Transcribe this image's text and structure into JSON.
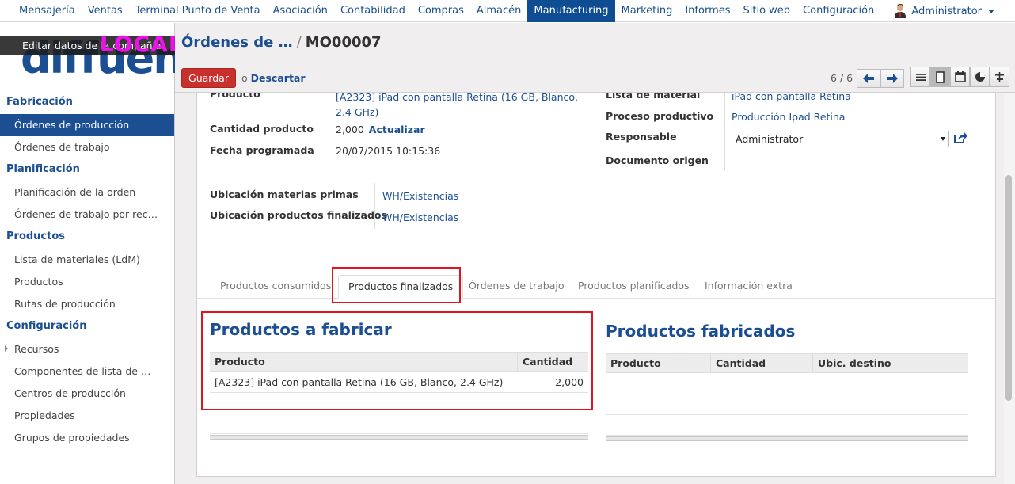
{
  "topbar": {
    "menu": [
      "Mensajería",
      "Ventas",
      "Terminal Punto de Venta",
      "Asociación",
      "Contabilidad",
      "Compras",
      "Almacén",
      "Manufacturing",
      "Marketing",
      "Informes",
      "Sitio web",
      "Configuración"
    ],
    "active": "Manufacturing",
    "user": "Administrator"
  },
  "sidebar": {
    "logo_text": "diffuen",
    "edit_company": "Editar datos de la compañía",
    "badge": "LOCAL",
    "sections": [
      {
        "title": "Fabricación",
        "items": [
          "Órdenes de producción",
          "Órdenes de trabajo"
        ]
      },
      {
        "title": "Planificación",
        "items": [
          "Planificación de la orden",
          "Órdenes de trabajo por rec…"
        ]
      },
      {
        "title": "Productos",
        "items": [
          "Lista de materiales (LdM)",
          "Productos",
          "Rutas de producción"
        ]
      },
      {
        "title": "Configuración",
        "items": [
          "Recursos",
          "Componentes de lista de …",
          "Centros de producción",
          "Propiedades",
          "Grupos de propiedades"
        ]
      }
    ],
    "active_item": "Órdenes de producción"
  },
  "header": {
    "breadcrumb_parent": "Órdenes de …",
    "breadcrumb_sep": "/",
    "breadcrumb_current": "MO00007",
    "save": "Guardar",
    "discard_or": "o",
    "discard": "Descartar",
    "pager": "6 / 6"
  },
  "form": {
    "left": [
      {
        "label": "Producto",
        "value": "[A2323] iPad con pantalla Retina (16 GB, Blanco, 2.4 GHz)"
      },
      {
        "label": "Cantidad producto",
        "value": "2,000",
        "action": "Actualizar"
      },
      {
        "label": "Fecha programada",
        "value": "20/07/2015 10:15:36"
      }
    ],
    "right": [
      {
        "label": "Lista de material",
        "value": "iPad con pantalla Retina"
      },
      {
        "label": "Proceso productivo",
        "value": "Producción Ipad Retina"
      },
      {
        "label": "Responsable",
        "value": "Administrator"
      },
      {
        "label": "Documento origen",
        "value": ""
      }
    ],
    "locations": [
      {
        "label": "Ubicación materias primas",
        "value": "WH/Existencias"
      },
      {
        "label": "Ubicación productos finalizados",
        "value": "WH/Existencias"
      }
    ]
  },
  "tabs": [
    "Productos consumidos",
    "Productos finalizados",
    "Órdenes de trabajo",
    "Productos planificados",
    "Información extra"
  ],
  "active_tab": "Productos finalizados",
  "to_produce": {
    "title": "Productos a fabricar",
    "columns": [
      "Producto",
      "Cantidad"
    ],
    "rows": [
      {
        "product": "[A2323] iPad con pantalla Retina (16 GB, Blanco, 2.4 GHz)",
        "qty": "2,000"
      }
    ]
  },
  "produced": {
    "title": "Productos fabricados",
    "columns": [
      "Producto",
      "Cantidad",
      "Ubic. destino"
    ],
    "rows": []
  },
  "colors": {
    "accent": "#1c4f92",
    "menu_active": "#0f4d92",
    "save": "#c9302c",
    "highlight": "#e0141e",
    "badge": "#ee11ee"
  }
}
